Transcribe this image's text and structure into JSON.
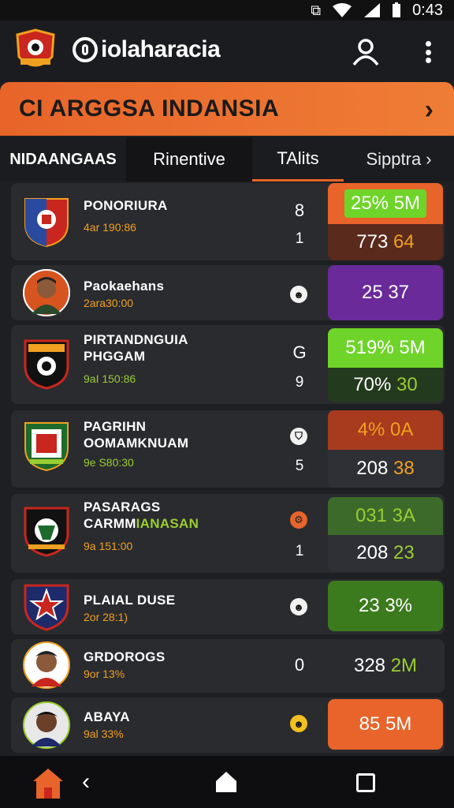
{
  "status_bar": {
    "time": "0:43",
    "icons": [
      "nfc-icon",
      "wifi-icon",
      "signal-icon",
      "battery-icon"
    ]
  },
  "app": {
    "title": "iolaharacia",
    "icons": [
      "club-crest-logo",
      "user-icon",
      "more-vert-icon"
    ]
  },
  "banner": {
    "title": "CI ARGGSA INDANSIA",
    "icon": "chevron-right-icon"
  },
  "tabs": [
    {
      "label": "NIDAANGAAS"
    },
    {
      "label": "Rinentive"
    },
    {
      "label": "TAlits"
    },
    {
      "label": "Sipptra"
    }
  ],
  "colors": {
    "accent": "#e8642a",
    "green": "#6fd42a",
    "purple": "#6a2a9a",
    "red": "#a83a1e",
    "dark_green": "#3c6a2a"
  },
  "teams": [
    {
      "name": "PONORIURA",
      "sub": "4ar 190:86",
      "score_top": "8",
      "score_bottom": "1",
      "stat_top": "25% 5M",
      "stat_bottom_a": "773",
      "stat_bottom_b": "64"
    },
    {
      "name": "Paokaehans",
      "sub": "2ara30:00",
      "icon": "face-icon",
      "stat": "25 37"
    },
    {
      "name_line1": "PIRTANDNGUIA",
      "name_line2": "PHGGAM",
      "sub": "9aI 150:86",
      "score_top": "G",
      "score_bottom": "9",
      "stat_top": "519% 5M",
      "stat_bottom_a": "70%",
      "stat_bottom_b": "30"
    },
    {
      "name_line1": "PAGRIHN",
      "name_line2": "OOMAMKNUAM",
      "sub": "9e S80:30",
      "icon": "shield-icon",
      "score_bottom": "5",
      "stat_top_a": "4%",
      "stat_top_b": "0A",
      "stat_bottom_a": "208",
      "stat_bottom_b": "38"
    },
    {
      "name_line1": "PASARAGS",
      "name_line2_a": "CARMM",
      "name_line2_b": "IANASAN",
      "sub": "9a 151:00",
      "icon": "gear-icon",
      "score_bottom": "1",
      "stat_top": "031 3A",
      "stat_bottom_a": "208",
      "stat_bottom_b": "23"
    },
    {
      "name": "PLAIAL DUSE",
      "sub": "2or 28:1)",
      "icon": "face-icon",
      "stat": "23 3%"
    },
    {
      "name": "GRDOROGS",
      "sub": "9or 13%",
      "score": "0",
      "stat_a": "328",
      "stat_b": "2M"
    },
    {
      "name": "ABAYA",
      "sub": "9al 33%",
      "icon": "face-icon",
      "stat": "85 5M"
    }
  ],
  "nav": {
    "icons": [
      "home-app-icon",
      "back-icon",
      "home-icon",
      "recents-icon"
    ]
  }
}
